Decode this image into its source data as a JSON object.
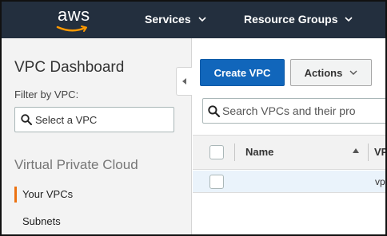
{
  "topnav": {
    "logo_text": "aws",
    "services_label": "Services",
    "resource_groups_label": "Resource Groups"
  },
  "sidebar": {
    "title": "VPC Dashboard",
    "filter_label": "Filter by VPC:",
    "filter_placeholder": "Select a VPC",
    "section_title": "Virtual Private Cloud",
    "items": [
      {
        "label": "Your VPCs",
        "active": true
      },
      {
        "label": "Subnets",
        "active": false
      }
    ]
  },
  "toolbar": {
    "create_label": "Create VPC",
    "actions_label": "Actions"
  },
  "search": {
    "placeholder": "Search VPCs and their pro"
  },
  "table": {
    "columns": [
      "Name",
      "VP"
    ],
    "rows": [
      {
        "name": "",
        "vpc": "vp"
      }
    ]
  },
  "colors": {
    "nav_bg": "#232f3e",
    "primary_button": "#1166bb",
    "active_accent": "#ec7211",
    "row_selected": "#eaf3fb"
  },
  "icons": {
    "search": "search-icon",
    "chevron": "chevron-down-icon",
    "collapse": "chevron-left-icon",
    "sort": "sort-up-icon"
  }
}
